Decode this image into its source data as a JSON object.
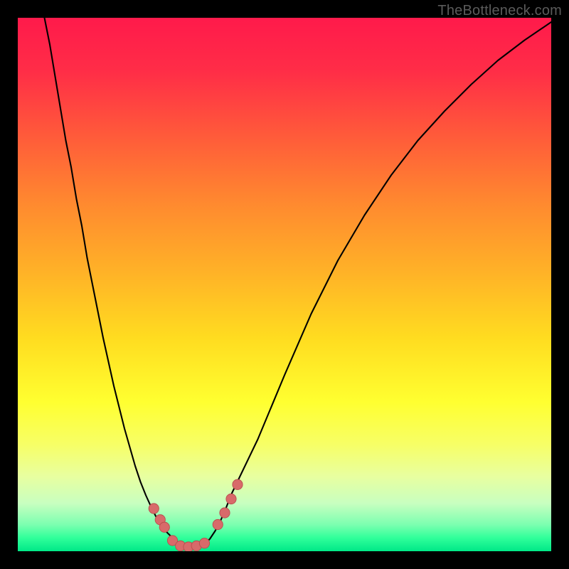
{
  "watermark": "TheBottleneck.com",
  "colors": {
    "frame": "#000000",
    "curve": "#000000",
    "marker_fill": "#d86a6a",
    "marker_stroke": "#b94e4e",
    "gradient_stops": [
      {
        "offset": 0.0,
        "color": "#ff1a4b"
      },
      {
        "offset": 0.1,
        "color": "#ff2d47"
      },
      {
        "offset": 0.22,
        "color": "#ff5a3a"
      },
      {
        "offset": 0.35,
        "color": "#ff8a2f"
      },
      {
        "offset": 0.48,
        "color": "#ffb327"
      },
      {
        "offset": 0.6,
        "color": "#ffdc20"
      },
      {
        "offset": 0.72,
        "color": "#ffff30"
      },
      {
        "offset": 0.8,
        "color": "#f7ff66"
      },
      {
        "offset": 0.86,
        "color": "#e8ffa0"
      },
      {
        "offset": 0.91,
        "color": "#c8ffc0"
      },
      {
        "offset": 0.95,
        "color": "#7cffb0"
      },
      {
        "offset": 0.975,
        "color": "#30ff9a"
      },
      {
        "offset": 1.0,
        "color": "#00e888"
      }
    ]
  },
  "chart_data": {
    "type": "line",
    "title": "",
    "xlabel": "",
    "ylabel": "",
    "xlim": [
      0,
      100
    ],
    "ylim": [
      0,
      100
    ],
    "x": [
      5,
      6,
      7,
      8,
      9,
      10,
      11,
      12,
      13,
      14,
      15,
      16,
      17,
      18,
      19,
      20,
      21,
      22,
      23,
      24,
      25,
      26,
      27,
      28,
      29,
      30,
      31,
      32,
      33,
      34,
      35,
      36,
      37,
      38,
      39,
      40,
      45,
      50,
      55,
      60,
      65,
      70,
      75,
      80,
      85,
      90,
      95,
      100
    ],
    "values": [
      100,
      95,
      89,
      83,
      77,
      72,
      66,
      61,
      55,
      50,
      45,
      40,
      35.5,
      31,
      27,
      23,
      19.5,
      16,
      13,
      10.5,
      8.3,
      6.3,
      4.8,
      3.5,
      2.5,
      1.7,
      1.1,
      0.7,
      0.5,
      0.7,
      1.3,
      2.3,
      3.8,
      5.7,
      8,
      10.6,
      21,
      33,
      44.5,
      54.5,
      63,
      70.5,
      77,
      82.5,
      87.5,
      92,
      95.8,
      99.2
    ],
    "markers": [
      {
        "x": 25.5,
        "y": 8.0
      },
      {
        "x": 26.7,
        "y": 5.9
      },
      {
        "x": 27.5,
        "y": 4.5
      },
      {
        "x": 29.0,
        "y": 2.0
      },
      {
        "x": 30.5,
        "y": 1.0
      },
      {
        "x": 32.0,
        "y": 0.8
      },
      {
        "x": 33.5,
        "y": 1.0
      },
      {
        "x": 35.0,
        "y": 1.5
      },
      {
        "x": 37.5,
        "y": 5.0
      },
      {
        "x": 38.8,
        "y": 7.2
      },
      {
        "x": 40.0,
        "y": 9.8
      },
      {
        "x": 41.2,
        "y": 12.5
      }
    ],
    "marker_radius_pct": 0.95
  }
}
